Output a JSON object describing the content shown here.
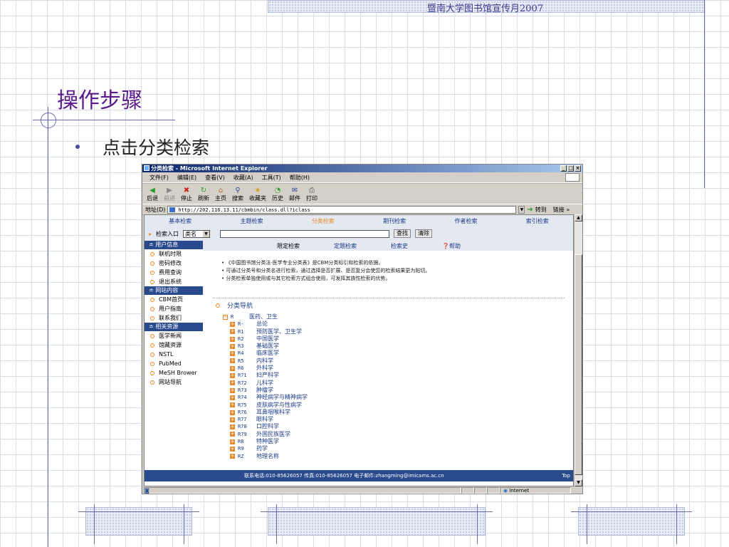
{
  "slide": {
    "header_text": "暨南大学图书馆宣传月2007",
    "title": "操作步骤",
    "bullet": "点击分类检索"
  },
  "browser": {
    "title": "分类检索 - Microsoft Internet Explorer",
    "menu": [
      "文件(F)",
      "编辑(E)",
      "查看(V)",
      "收藏(A)",
      "工具(T)",
      "帮助(H)"
    ],
    "toolbar": [
      {
        "label": "后退",
        "icon": "back-icon"
      },
      {
        "label": "前进",
        "icon": "forward-icon"
      },
      {
        "label": "停止",
        "icon": "stop-icon"
      },
      {
        "label": "刷新",
        "icon": "refresh-icon"
      },
      {
        "label": "主页",
        "icon": "home-icon"
      },
      {
        "label": "搜索",
        "icon": "search-icon"
      },
      {
        "label": "收藏夹",
        "icon": "favorites-icon"
      },
      {
        "label": "历史",
        "icon": "history-icon"
      },
      {
        "label": "邮件",
        "icon": "mail-icon"
      },
      {
        "label": "打印",
        "icon": "print-icon"
      }
    ],
    "address_label": "地址(D)",
    "address": "http://202.116.13.11/cbmbin/class.dll?iclass",
    "go_label": "转到",
    "links_label": "链接 »",
    "status_zone": "Internet"
  },
  "page": {
    "nav_tabs": [
      "基本检索",
      "主题检索",
      "分类检索",
      "期刊检索",
      "作者检索",
      "索引检索"
    ],
    "active_tab": "分类检索",
    "search_label": "检索入口",
    "search_field": "类名",
    "find_btn": "查找",
    "clear_btn": "清除",
    "sub_links": [
      "限定检索",
      "定题检索",
      "检索史",
      "帮助"
    ],
    "sidebar": [
      {
        "head": "用户信息",
        "items": [
          "联机时限",
          "密码修改",
          "费用查询",
          "退出系统"
        ]
      },
      {
        "head": "网站内容",
        "items": [
          "CBM首页",
          "用户指南",
          "联系我们"
        ]
      },
      {
        "head": "相关资源",
        "items": [
          "医学新闻",
          "馆藏资源",
          "NSTL",
          "PubMed",
          "MeSH Brower",
          "网站导航"
        ]
      }
    ],
    "notes": [
      "《中国图书馆分类法·医学专业分类表》是CBM分类标引和检索的依据。",
      "可通过分类号和分类名进行检索，通过选择是否扩展、是否复分会使您的检索结果更为贴切。",
      "分类检索单独使用或与其它检索方式组合使用，可发挥其族性检索的优势。"
    ],
    "nav_title": "分类导航",
    "tree_root": {
      "code": "R",
      "name": "医药、卫生"
    },
    "tree": [
      {
        "code": "R-",
        "name": "总论"
      },
      {
        "code": "R1",
        "name": "预防医学、卫生学"
      },
      {
        "code": "R2",
        "name": "中国医学"
      },
      {
        "code": "R3",
        "name": "基础医学"
      },
      {
        "code": "R4",
        "name": "临床医学"
      },
      {
        "code": "R5",
        "name": "内科学"
      },
      {
        "code": "R6",
        "name": "外科学"
      },
      {
        "code": "R71",
        "name": "妇产科学"
      },
      {
        "code": "R72",
        "name": "儿科学"
      },
      {
        "code": "R73",
        "name": "肿瘤学"
      },
      {
        "code": "R74",
        "name": "神经病学与精神病学"
      },
      {
        "code": "R75",
        "name": "皮肤病学与性病学"
      },
      {
        "code": "R76",
        "name": "耳鼻咽喉科学"
      },
      {
        "code": "R77",
        "name": "眼科学"
      },
      {
        "code": "R78",
        "name": "口腔科学"
      },
      {
        "code": "R79",
        "name": "外国民族医学"
      },
      {
        "code": "R8",
        "name": "特种医学"
      },
      {
        "code": "R9",
        "name": "药学"
      },
      {
        "code": "RZ",
        "name": "地理名称"
      }
    ],
    "footer": "联系电话:010-85626057    传真:010-85626057    电子邮件:zhangming@imicams.ac.cn",
    "footer_top": "Top"
  }
}
